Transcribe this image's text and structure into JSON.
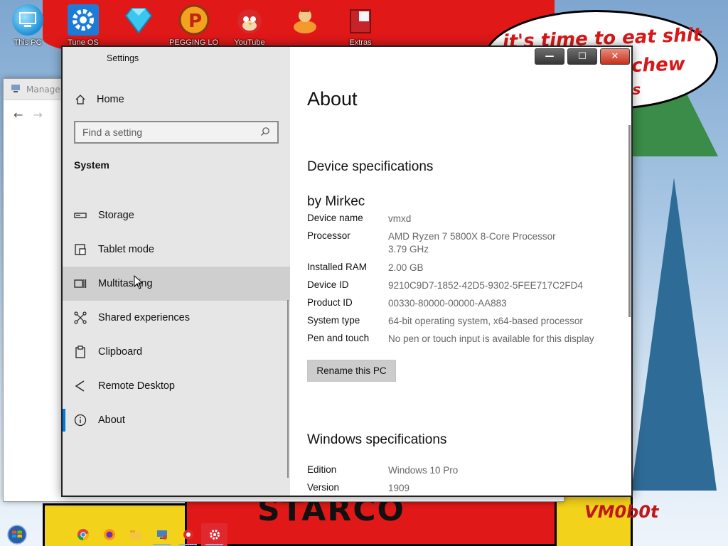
{
  "desktop": {
    "icons": [
      {
        "label": "This PC",
        "icon": "monitor-icon"
      },
      {
        "label": "Tune OS",
        "icon": "gear-icon"
      },
      {
        "label": "",
        "icon": "diamond-icon"
      },
      {
        "label": "PEGGING LOL",
        "icon": "p-badge-icon"
      },
      {
        "label": "YouTube",
        "icon": "angry-bird-icon"
      },
      {
        "label": "",
        "icon": "character-icon"
      },
      {
        "label": "Extras",
        "icon": "box-icon"
      }
    ],
    "wallpaper": {
      "bubble_lines": [
        "it's time to eat shit",
        "chew",
        "s"
      ],
      "starco": "STARCO",
      "signature": "VM0b0t"
    }
  },
  "background_window": {
    "title": "Manage"
  },
  "settings": {
    "window_title": "Settings",
    "controls": {
      "minimize": "—",
      "maximize": "☐",
      "close": "✕"
    },
    "home_label": "Home",
    "search_placeholder": "Find a setting",
    "section_label": "System",
    "nav_items": [
      {
        "label": "Storage",
        "icon": "storage-icon"
      },
      {
        "label": "Tablet mode",
        "icon": "tablet-mode-icon"
      },
      {
        "label": "Multitasking",
        "icon": "multitasking-icon"
      },
      {
        "label": "Shared experiences",
        "icon": "shared-experiences-icon"
      },
      {
        "label": "Clipboard",
        "icon": "clipboard-icon"
      },
      {
        "label": "Remote Desktop",
        "icon": "remote-desktop-icon"
      },
      {
        "label": "About",
        "icon": "info-icon"
      }
    ],
    "hovered_item": "Multitasking",
    "active_item": "About",
    "accent_color": "#0078d7",
    "content": {
      "title": "About",
      "device_heading": "Device specifications",
      "brand": "by Mirkec",
      "device_specs": [
        {
          "key": "Device name",
          "value": "vmxd"
        },
        {
          "key": "Processor",
          "value": "AMD Ryzen 7 5800X 8-Core Processor\n3.79 GHz"
        },
        {
          "key": "Installed RAM",
          "value": "2.00 GB"
        },
        {
          "key": "Device ID",
          "value": "9210C9D7-1852-42D5-9302-5FEE717C2FD4"
        },
        {
          "key": "Product ID",
          "value": "00330-80000-00000-AA883"
        },
        {
          "key": "System type",
          "value": "64-bit operating system, x64-based processor"
        },
        {
          "key": "Pen and touch",
          "value": "No pen or touch input is available for this display"
        }
      ],
      "rename_button": "Rename this PC",
      "windows_heading": "Windows specifications",
      "windows_specs": [
        {
          "key": "Edition",
          "value": "Windows 10 Pro"
        },
        {
          "key": "Version",
          "value": "1909"
        }
      ]
    }
  },
  "taskbar": {
    "items": [
      {
        "name": "chrome-icon",
        "running": false
      },
      {
        "name": "firefox-icon",
        "running": false
      },
      {
        "name": "file-explorer-icon",
        "running": false
      },
      {
        "name": "computer-management-icon",
        "running": true
      },
      {
        "name": "app-icon",
        "running": true
      },
      {
        "name": "settings-gear-icon",
        "running": true,
        "active": true
      }
    ]
  }
}
